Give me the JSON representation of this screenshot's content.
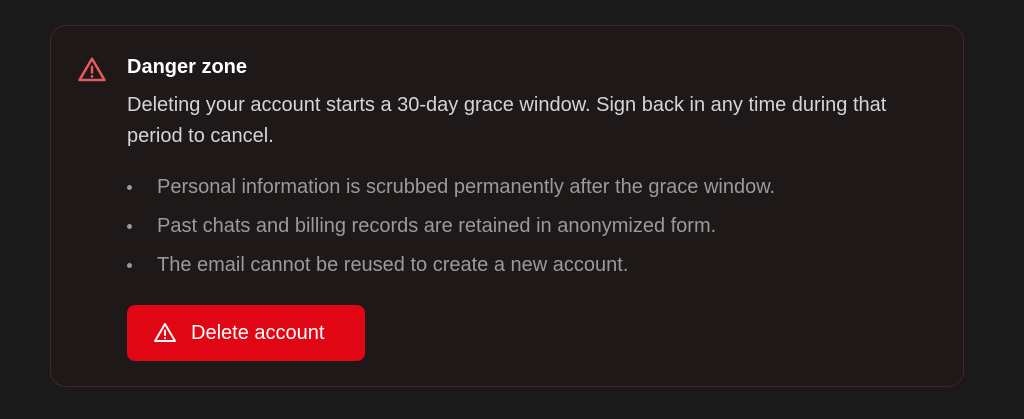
{
  "danger_zone": {
    "icon": "warning-triangle-icon",
    "title": "Danger zone",
    "description": "Deleting your account starts a 30-day grace window. Sign back in any time during that period to cancel.",
    "bullets": [
      "Personal information is scrubbed permanently after the grace window.",
      "Past chats and billing records are retained in anonymized form.",
      "The email cannot be reused to create a new account."
    ],
    "delete_button": {
      "label": "Delete account",
      "icon": "warning-triangle-icon"
    }
  },
  "colors": {
    "background": "#1a1a1a",
    "card_background": "#1e1818",
    "card_border": "#4a2325",
    "danger_accent": "#e85a5e",
    "button_red": "#e10613"
  }
}
